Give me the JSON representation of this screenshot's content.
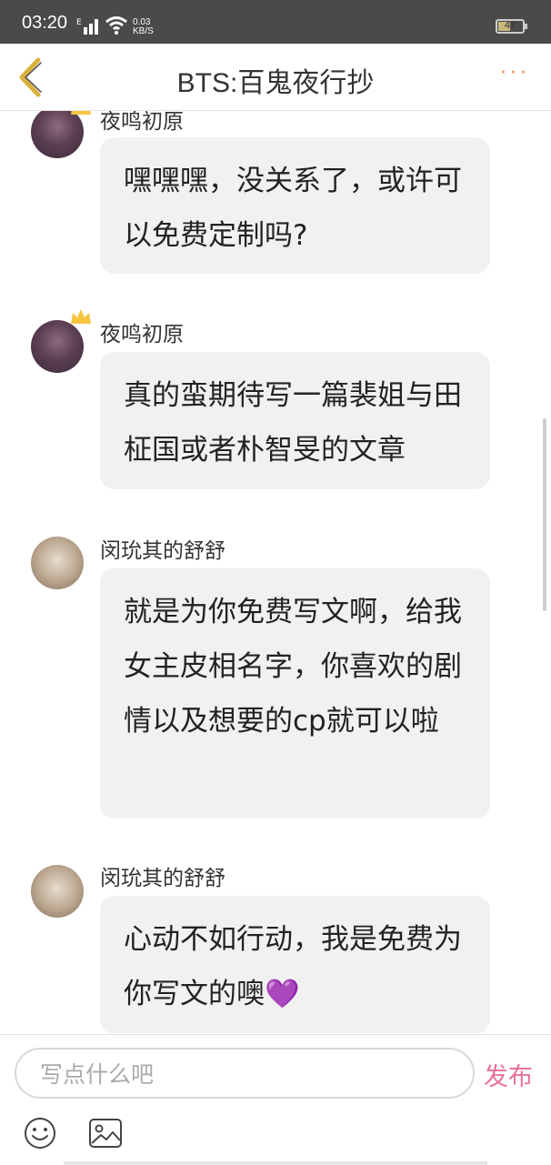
{
  "status_bar": {
    "time": "03:20",
    "network_type": "E",
    "speed_value": "0.03",
    "speed_unit": "KB/S",
    "battery": "47"
  },
  "header": {
    "title": "BTS:百鬼夜行抄",
    "back_icon": "chevron-left-icon",
    "more_icon": "more-dots-icon",
    "more_label": "···"
  },
  "messages": [
    {
      "author": "夜鸣初原",
      "text": "嘿嘿嘿，没关系了，或许可以免费定制吗?",
      "has_crown": true
    },
    {
      "author": "夜鸣初原",
      "text": "真的蛮期待写一篇裴姐与田柾国或者朴智旻的文章",
      "has_crown": true
    },
    {
      "author": "闵玧其的舒舒",
      "text": "就是为你免费写文啊，给我女主皮相名字，你喜欢的剧情以及想要的cp就可以啦",
      "has_crown": false
    },
    {
      "author": "闵玧其的舒舒",
      "text": "心动不如行动，我是免费为你写文的噢💜",
      "has_crown": false
    }
  ],
  "composer": {
    "placeholder": "写点什么吧",
    "value": "",
    "send_label": "发布",
    "emoji_icon": "smiley-icon",
    "image_icon": "image-icon"
  },
  "colors": {
    "status_bar_bg": "#4a4a4a",
    "accent_back": "#d9b13b",
    "accent_more": "#f08a5d",
    "send_color": "#e8719a",
    "bubble_bg": "#f1f1f1"
  }
}
